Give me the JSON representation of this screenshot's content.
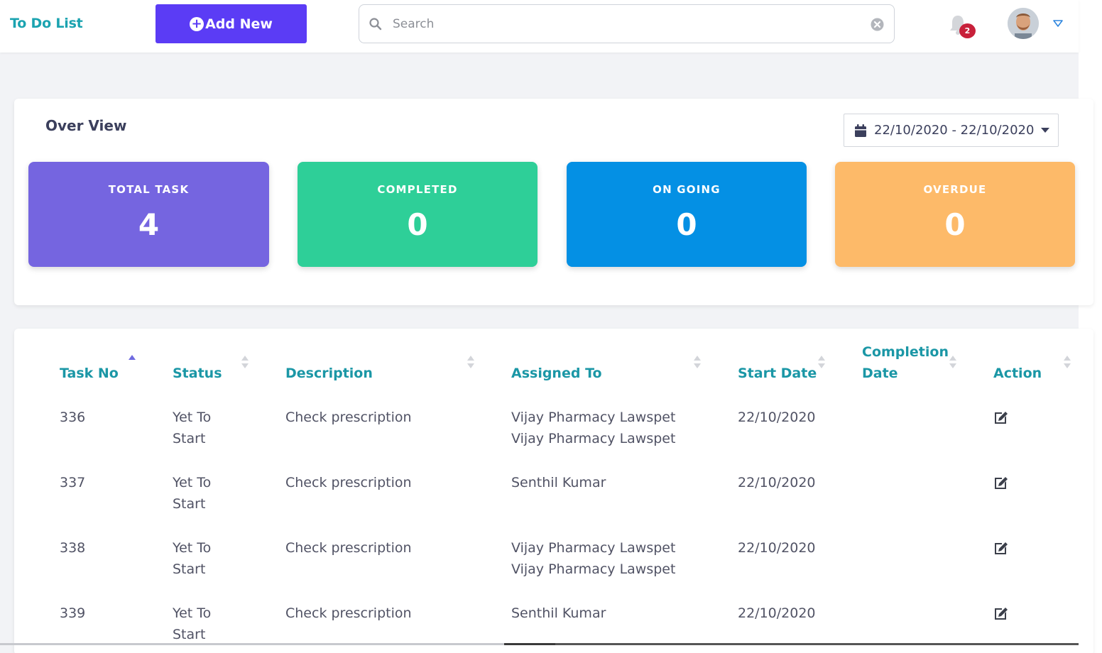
{
  "header": {
    "brand": "To Do List",
    "add_label": "Add New",
    "search_placeholder": "Search",
    "notification_count": "2"
  },
  "overview": {
    "title": "Over View",
    "date_range": "22/10/2020 - 22/10/2020",
    "stats": [
      {
        "label": "TOTAL TASK",
        "value": "4",
        "color": "#7565e0"
      },
      {
        "label": "COMPLETED",
        "value": "0",
        "color": "#2ecf98"
      },
      {
        "label": "ON GOING",
        "value": "0",
        "color": "#0490e4"
      },
      {
        "label": "OVERDUE",
        "value": "0",
        "color": "#fdba69"
      }
    ]
  },
  "table": {
    "columns": [
      "Task No",
      "Status",
      "Description",
      "Assigned To",
      "Start Date",
      "Completion Date",
      "Action"
    ],
    "completion_line1": "Completion",
    "completion_line2": "Date",
    "rows": [
      {
        "task_no": "336",
        "status_1": "Yet To",
        "status_2": "Start",
        "description": "Check prescription",
        "assigned_1": "Vijay Pharmacy Lawspet",
        "assigned_2": "Vijay Pharmacy Lawspet",
        "start_date": "22/10/2020",
        "completion_date": ""
      },
      {
        "task_no": "337",
        "status_1": "Yet To",
        "status_2": "Start",
        "description": "Check prescription",
        "assigned_1": "Senthil Kumar",
        "assigned_2": "",
        "start_date": "22/10/2020",
        "completion_date": ""
      },
      {
        "task_no": "338",
        "status_1": "Yet To",
        "status_2": "Start",
        "description": "Check prescription",
        "assigned_1": "Vijay Pharmacy Lawspet",
        "assigned_2": "Vijay Pharmacy Lawspet",
        "start_date": "22/10/2020",
        "completion_date": ""
      },
      {
        "task_no": "339",
        "status_1": "Yet To",
        "status_2": "Start",
        "description": "Check prescription",
        "assigned_1": "Senthil Kumar",
        "assigned_2": "",
        "start_date": "22/10/2020",
        "completion_date": ""
      }
    ],
    "action_icon": "edit-icon"
  },
  "icons": {
    "search": "search-icon",
    "clear": "clear-circle-icon",
    "bell": "bell-icon",
    "calendar": "calendar-icon",
    "caret": "caret-down-icon"
  }
}
